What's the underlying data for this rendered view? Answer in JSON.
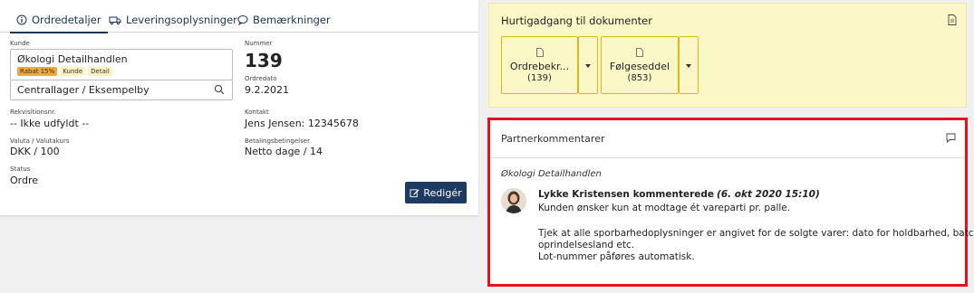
{
  "tabs": {
    "order_details": "Ordredetaljer",
    "delivery_info": "Leveringsoplysninger",
    "remarks": "Bemærkninger"
  },
  "order": {
    "customer_label": "Kunde",
    "customer_name": "Økologi Detailhandlen",
    "badges": [
      "Rabat 15%",
      "Kunde",
      "Detail"
    ],
    "location": "Centrallager / Eksempelby",
    "number_label": "Nummer",
    "number": "139",
    "date_label": "Ordredato",
    "date": "9.2.2021",
    "requisition_label": "Rekvisitionsnr.",
    "requisition": "-- Ikke udfyldt --",
    "contact_label": "Kontakt",
    "contact": "Jens Jensen: 12345678",
    "currency_label": "Valuta / Valutakurs",
    "currency": "DKK / 100",
    "payment_label": "Betalingsbetingelser",
    "payment": "Netto dage / 14",
    "status_label": "Status",
    "status": "Ordre",
    "edit_label": "Redigér"
  },
  "quick_access": {
    "title": "Hurtigadgang til dokumenter",
    "docs": [
      {
        "label": "Ordrebekr...",
        "count": "(139)"
      },
      {
        "label": "Følgeseddel",
        "count": "(853)"
      }
    ]
  },
  "partner": {
    "title": "Partnerkommentarer",
    "company": "Økologi Detailhandlen",
    "author": "Lykke Kristensen kommenterede",
    "date": "(6. okt 2020 15:10)",
    "lines": [
      "Kunden ønsker kun at modtage ét vareparti pr. palle.",
      "Tjek at alle sporbarhedoplysninger er angivet for de solgte varer: dato for holdbarhed, batch-nr.,",
      "oprindelsesland etc.",
      "Lot-nummer påføres automatisk."
    ]
  },
  "colors": {
    "accent": "#1e3a63",
    "highlight_border": "#e0141e",
    "quick_bg": "#fcf7c7",
    "doc_border": "#d7ba18"
  }
}
